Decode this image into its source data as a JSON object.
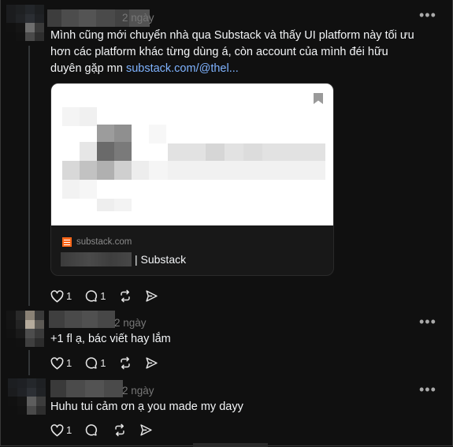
{
  "comments": [
    {
      "time": "2 ngày",
      "text": "Mình cũng mới chuyển nhà qua Substack và thấy UI platform này tối ưu hơn các platform khác từng dùng á, còn account của mình đéi hữu duyên gặp mn ",
      "link": "substack.com/@thel...",
      "likes": "1",
      "replies": "1"
    },
    {
      "time": "2 ngày",
      "text": "+1 fl ạ, bác viết hay lắm",
      "likes": "1",
      "replies": "1"
    },
    {
      "time": "2 ngày",
      "text": "Huhu tui cảm ơn ạ you made my dayy",
      "likes": "1",
      "replies": ""
    }
  ],
  "link_card": {
    "domain": "substack.com",
    "title_suffix": "| Substack"
  },
  "icons": {
    "more": "more-horizontal-icon",
    "like": "heart-icon",
    "reply": "comment-bubble-icon",
    "repost": "repost-icon",
    "share": "send-icon",
    "bookmark": "bookmark-icon",
    "favicon": "substack-favicon-icon"
  },
  "colors": {
    "background": "#101010",
    "link": "#7fb3ff",
    "substack_orange": "#ff6719",
    "muted": "#777777"
  }
}
